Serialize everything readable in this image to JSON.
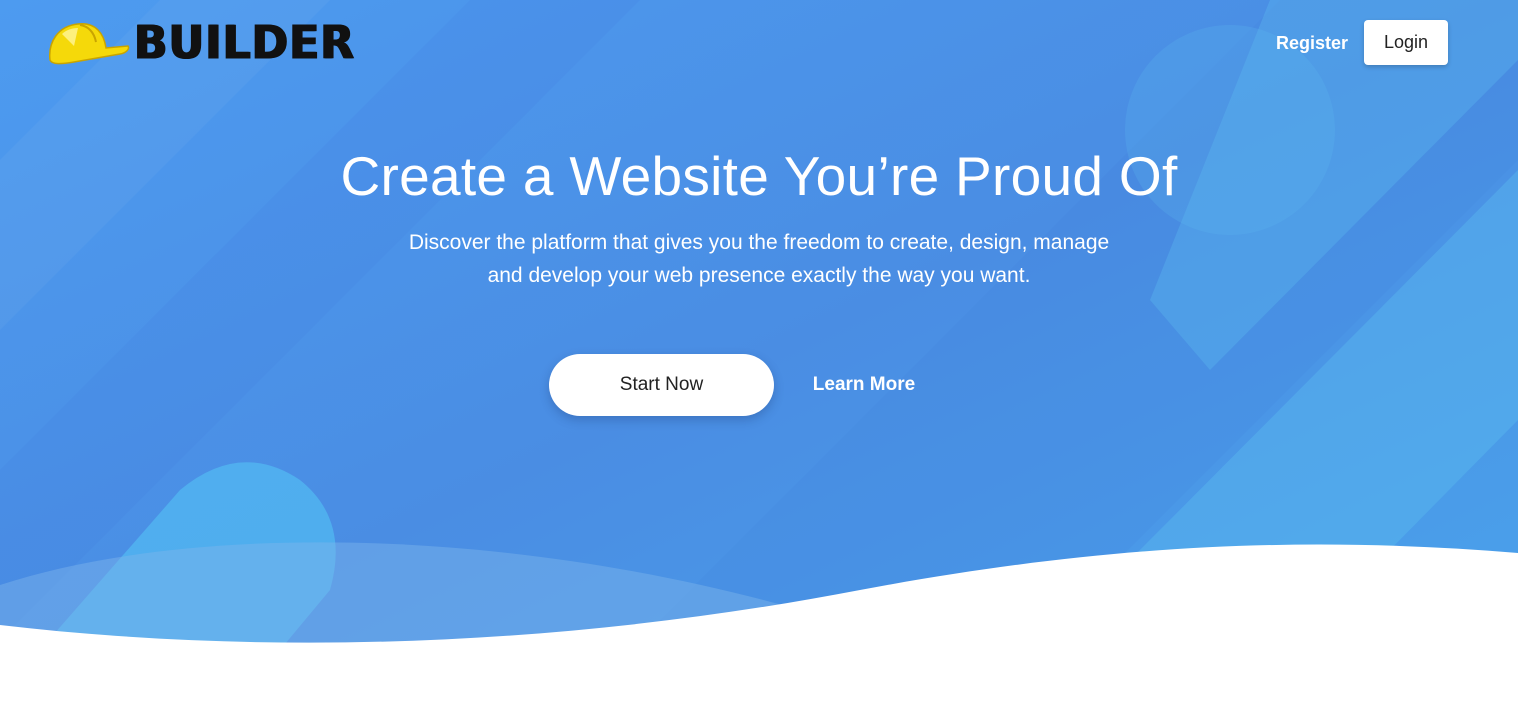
{
  "brand": {
    "name": "BUILDER",
    "logo_icon": "hard-hat-icon",
    "hat_color": "#f5d90a"
  },
  "nav": {
    "register_label": "Register",
    "login_label": "Login"
  },
  "hero": {
    "title": "Create a Website You’re Proud Of",
    "subtitle_line1": "Discover the platform that gives you the freedom to create, design, manage",
    "subtitle_line2": "and develop your web presence exactly the way you want.",
    "primary_cta": "Start Now",
    "secondary_cta": "Learn More"
  },
  "colors": {
    "hero_blue": "#4a90e6",
    "hero_blue_light": "#55b0ef",
    "white": "#ffffff",
    "text_dark": "#222222"
  }
}
